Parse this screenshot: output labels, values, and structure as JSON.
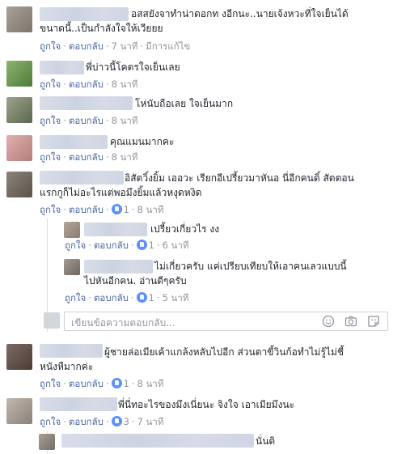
{
  "comments": [
    {
      "text_line1": "อสสยังจาทำน่าดอกท  งอีกนะ..นายเจ้งหวะที่ใจเย็นได้",
      "text_line2": "ขนาดนี้..เป็นกำลังใจให้เวียยย",
      "like": "ถูกใจ",
      "reply": "ตอบกลับ",
      "time": "7 นาที",
      "edit": "มีการแก้ไข"
    },
    {
      "text_line1": "พี่บ่าวนี้โคตรใจเย็นเลย",
      "like": "ถูกใจ",
      "reply": "ตอบกลับ",
      "time": "8 นาที"
    },
    {
      "text_line1": "โห่นับถือเลย ใจเย็นมาก",
      "like": "ถูกใจ",
      "reply": "ตอบกลับ",
      "time": "8 นาที"
    },
    {
      "text_line1": "คุณแมนมากคะ",
      "like": "ถูกใจ",
      "reply": "ตอบกลับ",
      "time": "8 นาที"
    },
    {
      "text_line1": "อิสัตวิ์งยิ้ม เออวะ เรียกอีเปรี้ยวมาหันอ  นี่อีกคนดิ์ สัตตอน",
      "text_line2": "แรกกูก็ไม่อะไรแต่พอมึงยิ้มแล้วหงุดหงิด",
      "like": "ถูกใจ",
      "reply": "ตอบกลับ",
      "likes": "1",
      "time": "8 นาที"
    },
    {
      "text_line1": "เปรี้ยวเกี่ยวไร งง",
      "like": "ถูกใจ",
      "reply": "ตอบกลับ",
      "likes": "1",
      "time": "6 นาที"
    },
    {
      "text_line1": "ไม่เกี่ยวครับ แค่เปรียบเทียบให้เอาคนเลวแบบนี้",
      "text_line2": "ไปหันอีกคน. อ่านดีๆครับ",
      "like": "ถูกใจ",
      "reply": "ตอบกลับ",
      "likes": "1",
      "time": "5 นาที"
    },
    {
      "text_line1": "ผู้ชายล่อเมียเค้าแกล้งหลับไปอีก ส่วนตาขี้วินก้อทำไม่รู้ไม่ชี้",
      "text_line2": "หนังหืมากค่ะ",
      "like": "ถูกใจ",
      "reply": "ตอบกลับ",
      "likes": "1",
      "time": "8 นาที"
    },
    {
      "text_line1": "พี่นี่ทอะไรของมึงเนี่ยนะ จิงใจ เอาเมียมึงนะ",
      "like": "ถูกใจ",
      "reply": "ตอบกลับ",
      "likes": "3",
      "time": "7 นาที"
    },
    {
      "text_line1": "นั่นดิ"
    }
  ],
  "reply_box": {
    "placeholder": "เขียนข้อความตอบกลับ..."
  },
  "icons": [
    "emoji-icon",
    "camera-icon",
    "sticker-icon"
  ],
  "colors": {
    "link": "#4b67a1",
    "meta": "#90949c",
    "like_badge": "#5890ff"
  }
}
